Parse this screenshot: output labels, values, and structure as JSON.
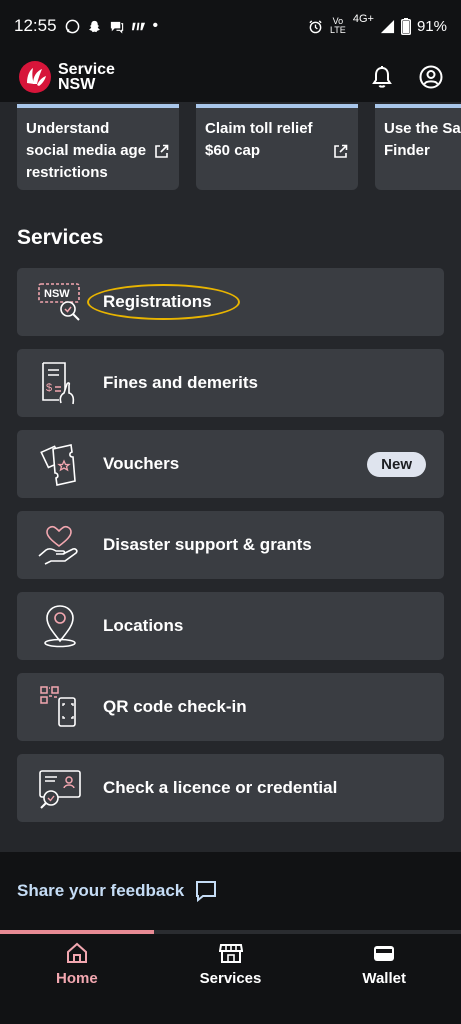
{
  "status_bar": {
    "time": "12:55",
    "network": "4G+",
    "volte": "Vo LTE",
    "battery": "91%"
  },
  "header": {
    "logo_line1": "Service",
    "logo_line2": "NSW"
  },
  "promo_cards": [
    {
      "text": "Understand social media age restrictions"
    },
    {
      "text": "Claim toll relief $60 cap"
    },
    {
      "text": "Use the Sa Finder"
    }
  ],
  "services": {
    "title": "Services",
    "items": [
      {
        "label": "Registrations",
        "icon": "nsw-registration-icon"
      },
      {
        "label": "Fines and demerits",
        "icon": "fines-document-icon"
      },
      {
        "label": "Vouchers",
        "icon": "voucher-icon",
        "badge": "New"
      },
      {
        "label": "Disaster support & grants",
        "icon": "heart-hand-icon"
      },
      {
        "label": "Locations",
        "icon": "location-pin-icon"
      },
      {
        "label": "QR code check-in",
        "icon": "qr-phone-icon"
      },
      {
        "label": "Check a licence or credential",
        "icon": "licence-check-icon"
      }
    ]
  },
  "feedback": {
    "label": "Share your feedback"
  },
  "bottom_nav": {
    "items": [
      {
        "label": "Home",
        "icon": "home-icon",
        "active": true
      },
      {
        "label": "Services",
        "icon": "store-icon"
      },
      {
        "label": "Wallet",
        "icon": "wallet-icon"
      }
    ]
  },
  "colors": {
    "accent_pink": "#f2a7b0",
    "card_bg": "#3a3d42",
    "highlight": "#e8b400"
  }
}
